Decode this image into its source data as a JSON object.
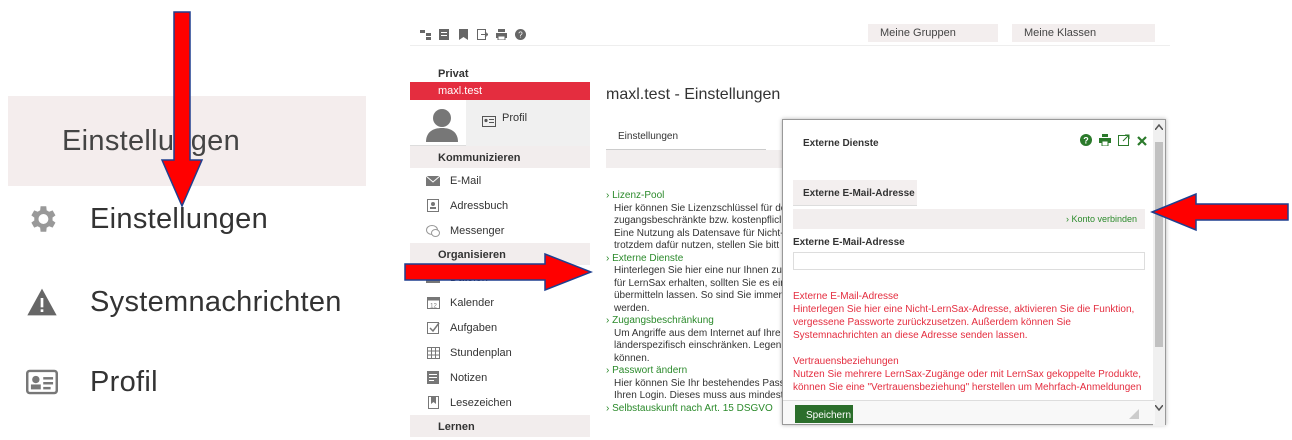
{
  "zoom": {
    "highlight_label": "Einstellungen",
    "items": [
      {
        "icon": "gear-icon",
        "label": "Einstellungen"
      },
      {
        "icon": "warning-icon",
        "label": "Systemnachrichten"
      },
      {
        "icon": "id-card-icon",
        "label": "Profil"
      }
    ]
  },
  "topbar": {
    "groups_label": "Meine Gruppen",
    "classes_label": "Meine Klassen"
  },
  "sidebar": {
    "private_heading": "Privat",
    "active_item": "maxl.test",
    "profile_label": "Profil",
    "communicate_heading": "Kommunizieren",
    "communicate_items": [
      "E-Mail",
      "Adressbuch",
      "Messenger"
    ],
    "organize_heading": "Organisieren",
    "organize_items": [
      "Dateien",
      "Kalender",
      "Aufgaben",
      "Stundenplan",
      "Notizen",
      "Lesezeichen"
    ],
    "learn_heading": "Lernen"
  },
  "main": {
    "title": "maxl.test - Einstellungen",
    "tab_label": "Einstellungen",
    "sections": [
      {
        "title": "Lizenz-Pool",
        "lines": [
          "Hier können Sie Lizenzschlüssel für de",
          "zugangsbeschränkte bzw. kostenpflicl",
          "Eine Nutzung als Datensave für Nicht-",
          "trotzdem dafür nutzen, stellen Sie bitt"
        ]
      },
      {
        "title": "Externe Dienste",
        "lines": [
          "Hinterlegen Sie hier eine nur Ihnen zu",
          "für LernSax erhalten, sollten Sie es eir",
          "übermitteln lassen. So sind Sie immer",
          "werden."
        ]
      },
      {
        "title": "Zugangsbeschränkung",
        "lines": [
          "Um Angriffe aus dem Internet auf Ihre",
          "länderspezifisch einschränken. Legen",
          "können."
        ]
      },
      {
        "title": "Passwort ändern",
        "lines": [
          "Hier können Sie Ihr bestehendes Pass",
          "Ihren Login. Dieses muss aus mindesten"
        ]
      },
      {
        "title": "Selbstauskunft nach Art. 15 DSGVO",
        "lines": []
      }
    ]
  },
  "dialog": {
    "title": "Externe Dienste",
    "tab_label": "Externe E-Mail-Adresse",
    "connect_link": "Konto verbinden",
    "field_label": "Externe E-Mail-Adresse",
    "field_value": "",
    "info_1_title": "Externe E-Mail-Adresse",
    "info_1_text": "Hinterlegen Sie hier eine Nicht-LernSax-Adresse, aktivieren Sie die Funktion, vergessene Passworte zurückzusetzen. Außerdem können Sie Systemnachrichten an diese Adresse senden lassen.",
    "info_2_title": "Vertrauensbeziehungen",
    "info_2_text": "Nutzen Sie mehrere LernSax-Zugänge oder mit LernSax gekoppelte Produkte, können Sie eine \"Vertrauensbeziehung\" herstellen um Mehrfach-Anmeldungen",
    "save_label": "Speichern"
  },
  "colors": {
    "accent_red": "#e42d3f",
    "link_green": "#2b8a2b",
    "save_green": "#2b6e2b",
    "arrow_red": "#ff0000",
    "arrow_outline": "#1f3f8f"
  }
}
